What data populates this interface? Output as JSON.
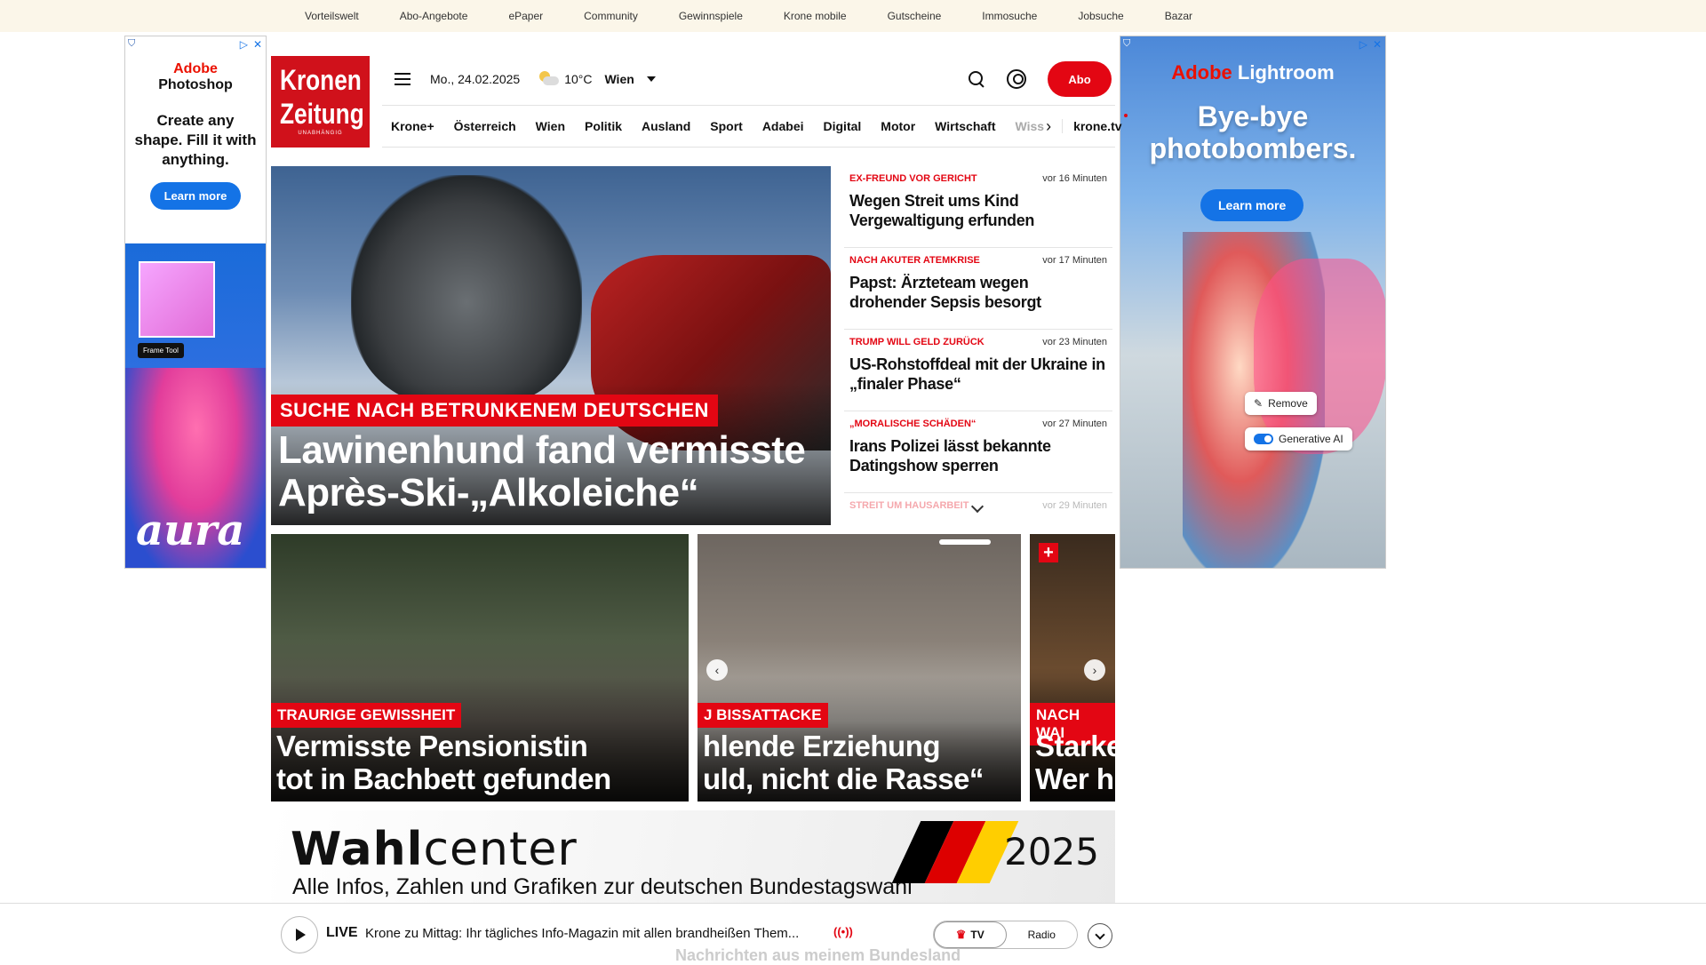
{
  "topbar": {
    "links": [
      "Vorteilswelt",
      "Abo-Angebote",
      "ePaper",
      "Community",
      "Gewinnspiele",
      "Krone mobile",
      "Gutscheine",
      "Immosuche",
      "Jobsuche",
      "Bazar"
    ]
  },
  "ad_left": {
    "brand_red": "Adobe",
    "brand": "Photoshop",
    "headline": "Create any shape. Fill it with anything.",
    "cta": "Learn more",
    "frame_tool": "Frame Tool",
    "aura": "aura"
  },
  "ad_right": {
    "brand_red": "Adobe",
    "brand": "Lightroom",
    "headline": "Bye-bye photobombers.",
    "cta": "Learn more",
    "remove": "Remove",
    "generative": "Generative AI"
  },
  "logo": {
    "line1": "Kronen",
    "line2": "Zeitung",
    "sub": "UNABHÄNGIG"
  },
  "header": {
    "date": "Mo., 24.02.2025",
    "temperature": "10°C",
    "city": "Wien",
    "abo": "Abo"
  },
  "nav": {
    "items": [
      "Krone+",
      "Österreich",
      "Wien",
      "Politik",
      "Ausland",
      "Sport",
      "Adabei",
      "Digital",
      "Motor",
      "Wirtschaft"
    ],
    "fade": "Wiss",
    "kronetv": "krone.tv"
  },
  "hero": {
    "kicker": "SUCHE NACH BETRUNKENEM DEUTSCHEN",
    "title": "Lawinenhund fand vermisste Après-Ski-„Alkoleiche“"
  },
  "ticker": [
    {
      "kicker": "EX-FREUND VOR GERICHT",
      "time": "vor 16 Minuten",
      "headline": "Wegen Streit ums Kind Vergewaltigung erfunden"
    },
    {
      "kicker": "NACH AKUTER ATEMKRISE",
      "time": "vor 17 Minuten",
      "headline": "Papst: Ärzteteam wegen drohender Sepsis besorgt"
    },
    {
      "kicker": "TRUMP WILL GELD ZURÜCK",
      "time": "vor 23 Minuten",
      "headline": "US-Rohstoffdeal mit der Ukraine in „finaler Phase“"
    },
    {
      "kicker": "„MORALISCHE SCHÄDEN“",
      "time": "vor 27 Minuten",
      "headline": "Irans Polizei lässt bekannte Datingshow sperren"
    },
    {
      "kicker": "STREIT UM HAUSARBEIT",
      "time": "vor 29 Minuten",
      "headline": ""
    }
  ],
  "cards": [
    {
      "kicker": "TRAURIGE GEWISSHEIT",
      "line1": "Vermisste Pensionistin",
      "line2": "tot in Bachbett gefunden"
    },
    {
      "kicker": "J BISSATTACKE",
      "line1": "hlende Erziehung",
      "line2": "uld, nicht die Rasse“"
    },
    {
      "kicker": "NACH WAI",
      "line1": "Starke",
      "line2": "Wer hi"
    }
  ],
  "wahl": {
    "title_bold": "Wahl",
    "title_rest": "center",
    "subtitle": "Alle Infos, Zahlen und Grafiken zur deutschen Bundestagswahl",
    "year": "2025",
    "flag_colors": [
      "#000000",
      "#dd0000",
      "#ffce00"
    ]
  },
  "player": {
    "live": "LIVE",
    "description": "Krone zu Mittag: Ihr tägliches Info-Magazin mit allen brandheißen Them...",
    "radio_signal": "((•))",
    "tv": "TV",
    "radio": "Radio",
    "behind_text": "Nachrichten aus meinem Bundesland"
  },
  "colors": {
    "accent": "#e30613",
    "logo_red": "#d0111b",
    "adobe_blue": "#1473e6"
  }
}
